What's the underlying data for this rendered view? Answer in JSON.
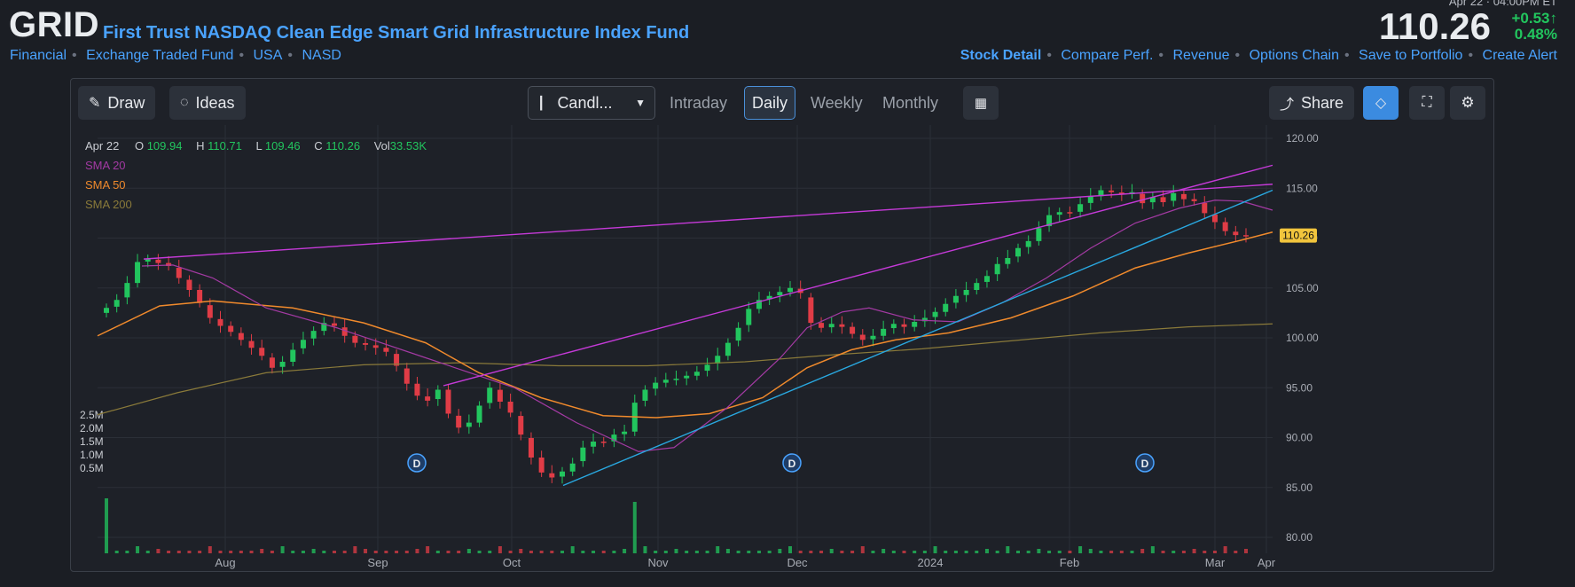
{
  "header": {
    "ticker": "GRID",
    "name": "First Trust NASDAQ Clean Edge Smart Grid Infrastructure Index Fund",
    "meta": [
      "Financial",
      "Exchange Traded Fund",
      "USA",
      "NASD"
    ]
  },
  "quote": {
    "time": "Apr 22 · 04:00PM ET",
    "price": "110.26",
    "change": "+0.53",
    "change_pct": "0.48%"
  },
  "nav": [
    "Stock Detail",
    "Compare Perf.",
    "Revenue",
    "Options Chain",
    "Save to Portfolio",
    "Create Alert"
  ],
  "toolbar": {
    "draw": "Draw",
    "ideas": "Ideas",
    "chart_type": "Candl...",
    "periods": [
      "Intraday",
      "Daily",
      "Weekly",
      "Monthly"
    ],
    "active_period": "Daily",
    "share": "Share"
  },
  "ohlc": {
    "date": "Apr 22",
    "o_label": "O",
    "o": "109.94",
    "h_label": "H",
    "h": "110.71",
    "l_label": "L",
    "l": "109.46",
    "c_label": "C",
    "c": "110.26",
    "vol_label": "Vol",
    "vol": "33.53K"
  },
  "legend": [
    {
      "label": "SMA 20",
      "color": "#a33aa3"
    },
    {
      "label": "SMA 50",
      "color": "#f08a2c"
    },
    {
      "label": "SMA 200",
      "color": "#8a7a3a"
    }
  ],
  "colors": {
    "up": "#22c55e",
    "down": "#e03c46",
    "accent": "#4aa3ff",
    "trend_magenta": "#c53ad8",
    "trend_blue": "#29a8e0"
  },
  "chart_data": {
    "type": "candlestick",
    "ylim": [
      80,
      120
    ],
    "y_ticks": [
      "120.00",
      "115.00",
      "110.00",
      "105.00",
      "100.00",
      "95.00",
      "90.00",
      "85.00",
      "80.00"
    ],
    "x_ticks": [
      "Aug",
      "Sep",
      "Oct",
      "Nov",
      "Dec",
      "2024",
      "Feb",
      "Mar",
      "Apr"
    ],
    "volume_ticks": [
      "2.5M",
      "2.0M",
      "1.5M",
      "1.0M",
      "0.5M"
    ],
    "last_price_label": "110.26",
    "dividend_markers": [
      "D",
      "D",
      "D"
    ],
    "close_path": [
      103,
      103.8,
      105.5,
      107.6,
      107.9,
      107.5,
      107.2,
      106,
      104.8,
      103.5,
      102,
      101.2,
      100.6,
      99.8,
      99,
      98.2,
      97,
      97.6,
      98.8,
      99.8,
      100.7,
      101.5,
      101.2,
      100.2,
      99.5,
      99.3,
      99,
      98.6,
      97.2,
      95.4,
      94.2,
      93.7,
      94.8,
      92.4,
      91,
      91.5,
      93.2,
      95,
      93.6,
      92.5,
      90.3,
      88,
      86.5,
      86,
      86.6,
      87.4,
      89,
      89.6,
      89.5,
      90.3,
      90.6,
      93.5,
      94.8,
      95.5,
      95.8,
      95.9,
      96.2,
      96.6,
      97.3,
      98.2,
      99.5,
      101,
      102.9,
      103.8,
      104.2,
      104.6,
      105,
      104.5,
      101.5,
      101,
      101.4,
      101.1,
      100.4,
      99.8,
      100.2,
      100.9,
      101.4,
      101.1,
      101.6,
      102,
      102.6,
      103.4,
      104.2,
      104.8,
      105.5,
      106.2,
      107.4,
      108,
      109,
      109.7,
      111,
      112.3,
      112.6,
      112.5,
      113.4,
      114.2,
      114.8,
      114.6,
      114.4,
      114.6,
      113.5,
      114.1,
      113.6,
      114.5,
      113.9,
      113.7,
      112.5,
      111.6,
      110.7,
      110.3,
      110.26
    ],
    "sma20": [
      [
        80,
        107.2
      ],
      [
        115,
        107.3
      ],
      [
        160,
        106
      ],
      [
        220,
        103
      ],
      [
        300,
        101
      ],
      [
        400,
        98
      ],
      [
        500,
        95
      ],
      [
        570,
        91.5
      ],
      [
        640,
        88.6
      ],
      [
        680,
        89
      ],
      [
        740,
        93
      ],
      [
        800,
        98
      ],
      [
        830,
        101
      ],
      [
        870,
        102.6
      ],
      [
        900,
        103
      ],
      [
        950,
        101.8
      ],
      [
        1000,
        101.6
      ],
      [
        1050,
        103.5
      ],
      [
        1100,
        106
      ],
      [
        1150,
        109
      ],
      [
        1200,
        111.5
      ],
      [
        1250,
        113
      ],
      [
        1290,
        113.8
      ],
      [
        1320,
        113.7
      ],
      [
        1355,
        112.8
      ]
    ],
    "sma50": [
      [
        30,
        100.2
      ],
      [
        100,
        103.2
      ],
      [
        160,
        103.7
      ],
      [
        250,
        103
      ],
      [
        330,
        101.5
      ],
      [
        400,
        99.5
      ],
      [
        460,
        96.5
      ],
      [
        530,
        94
      ],
      [
        600,
        92.2
      ],
      [
        660,
        92
      ],
      [
        720,
        92.4
      ],
      [
        780,
        94
      ],
      [
        830,
        97
      ],
      [
        880,
        98.8
      ],
      [
        930,
        99.8
      ],
      [
        990,
        100.5
      ],
      [
        1060,
        102
      ],
      [
        1130,
        104.2
      ],
      [
        1200,
        107
      ],
      [
        1260,
        108.5
      ],
      [
        1320,
        109.8
      ],
      [
        1355,
        110.6
      ]
    ],
    "sma200": [
      [
        30,
        92.3
      ],
      [
        120,
        94.5
      ],
      [
        220,
        96.5
      ],
      [
        330,
        97.3
      ],
      [
        440,
        97.5
      ],
      [
        550,
        97.2
      ],
      [
        650,
        97.2
      ],
      [
        760,
        97.6
      ],
      [
        860,
        98.3
      ],
      [
        960,
        98.9
      ],
      [
        1060,
        99.7
      ],
      [
        1160,
        100.5
      ],
      [
        1260,
        101.1
      ],
      [
        1355,
        101.4
      ]
    ],
    "trendlines": [
      {
        "color": "magenta",
        "from": [
          82,
          107.9
        ],
        "to": [
          1355,
          115.4
        ]
      },
      {
        "color": "magenta",
        "from": [
          420,
          95.2
        ],
        "to": [
          1355,
          117.3
        ]
      },
      {
        "color": "blue",
        "from": [
          555,
          85.2
        ],
        "to": [
          1355,
          114.8
        ]
      }
    ]
  }
}
